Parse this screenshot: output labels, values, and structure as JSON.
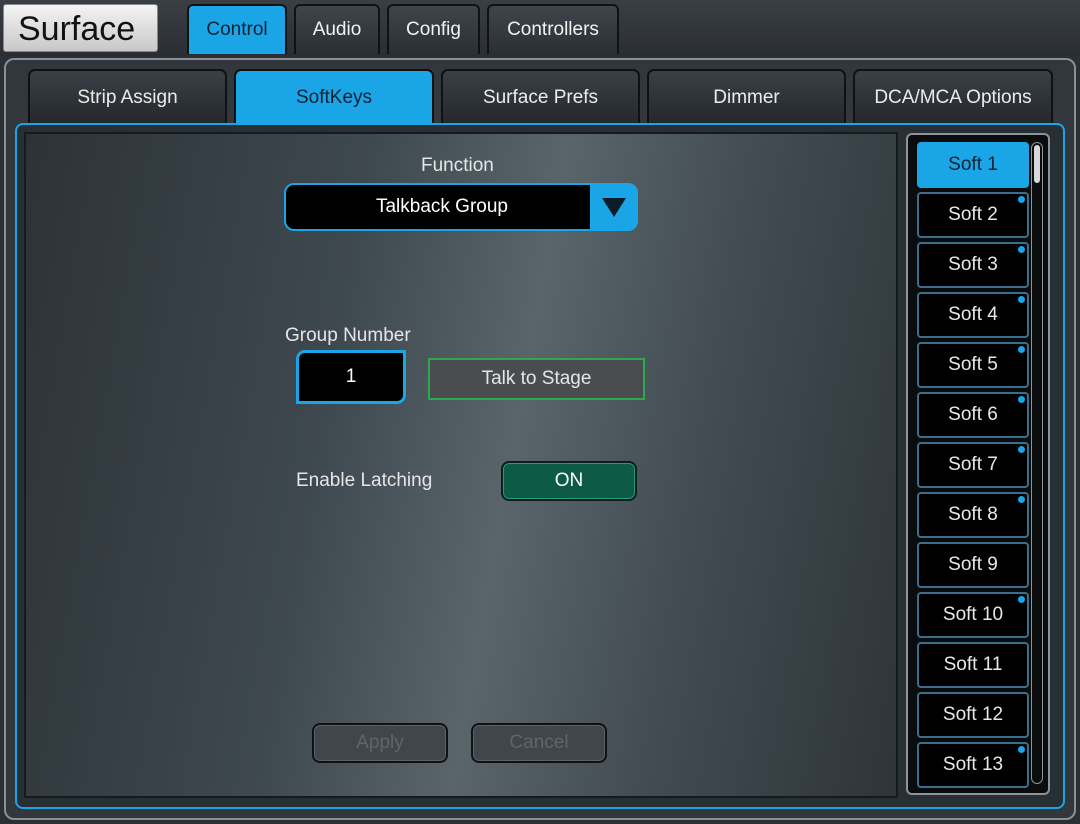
{
  "header": {
    "title": "Surface"
  },
  "top_tabs": [
    {
      "label": "Control",
      "active": true
    },
    {
      "label": "Audio",
      "active": false
    },
    {
      "label": "Config",
      "active": false
    },
    {
      "label": "Controllers",
      "active": false
    }
  ],
  "sub_tabs": [
    {
      "label": "Strip Assign",
      "active": false
    },
    {
      "label": "SoftKeys",
      "active": true
    },
    {
      "label": "Surface Prefs",
      "active": false
    },
    {
      "label": "Dimmer",
      "active": false
    },
    {
      "label": "DCA/MCA Options",
      "active": false
    }
  ],
  "function": {
    "label": "Function",
    "value": "Talkback Group",
    "icon": "triangle-down-icon"
  },
  "group": {
    "label": "Group Number",
    "number": "1",
    "name": "Talk to Stage"
  },
  "latching": {
    "label": "Enable Latching",
    "value": "ON"
  },
  "actions": {
    "apply": "Apply",
    "cancel": "Cancel"
  },
  "softkeys": [
    {
      "label": "Soft 1",
      "selected": true,
      "assigned": false
    },
    {
      "label": "Soft 2",
      "selected": false,
      "assigned": true
    },
    {
      "label": "Soft 3",
      "selected": false,
      "assigned": true
    },
    {
      "label": "Soft 4",
      "selected": false,
      "assigned": true
    },
    {
      "label": "Soft 5",
      "selected": false,
      "assigned": true
    },
    {
      "label": "Soft 6",
      "selected": false,
      "assigned": true
    },
    {
      "label": "Soft 7",
      "selected": false,
      "assigned": true
    },
    {
      "label": "Soft 8",
      "selected": false,
      "assigned": true
    },
    {
      "label": "Soft 9",
      "selected": false,
      "assigned": false
    },
    {
      "label": "Soft 10",
      "selected": false,
      "assigned": true
    },
    {
      "label": "Soft 11",
      "selected": false,
      "assigned": false
    },
    {
      "label": "Soft 12",
      "selected": false,
      "assigned": false
    },
    {
      "label": "Soft 13",
      "selected": false,
      "assigned": true
    }
  ],
  "colors": {
    "accent": "#1aa6e6",
    "on": "#0d5a47",
    "group_border": "#2da94b"
  }
}
